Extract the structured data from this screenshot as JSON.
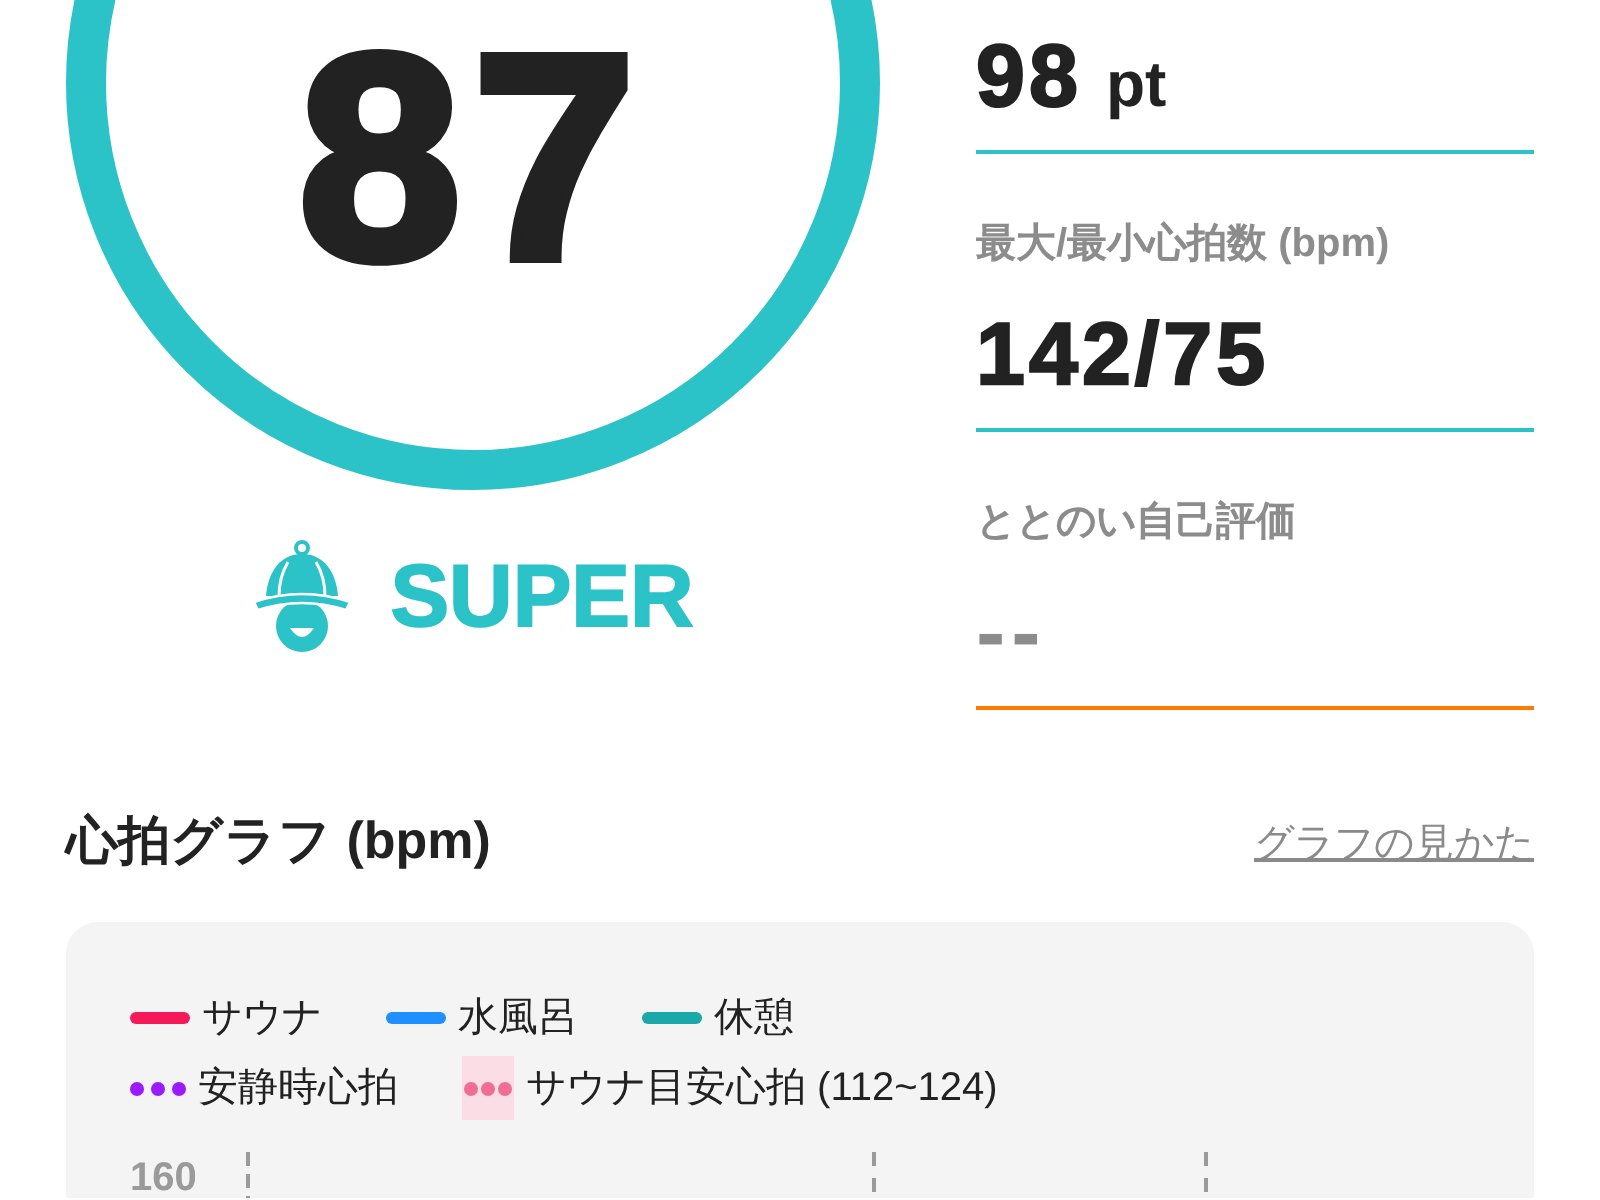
{
  "score": {
    "value": "87",
    "rank": "SUPER"
  },
  "stats": [
    {
      "kind": "value",
      "value": "98",
      "unit": "pt",
      "color": "#2bc2c8"
    },
    {
      "kind": "value",
      "label": "最大/最小心拍数 (bpm)",
      "value": "142/75",
      "color": "#2bc2c8"
    },
    {
      "kind": "empty",
      "label": "ととのい自己評価",
      "value": "--",
      "color": "#ff7a00"
    }
  ],
  "heart_rate_graph": {
    "title": "心拍グラフ (bpm)",
    "help_link": "グラフの見かた",
    "legend_rows": [
      [
        {
          "kind": "line",
          "label": "サウナ",
          "color": "#f5195a"
        },
        {
          "kind": "line",
          "label": "水風呂",
          "color": "#1e90ff"
        },
        {
          "kind": "line",
          "label": "休憩",
          "color": "#1aa8a8"
        }
      ],
      [
        {
          "kind": "dots",
          "label": "安静時心拍",
          "color": "#9b1aff"
        },
        {
          "kind": "band",
          "label": "サウナ目安心拍 (112~124)",
          "color": "#f06e96",
          "band": {
            "color": "#fbdde6"
          }
        }
      ]
    ],
    "y_tick_label": "160"
  }
}
